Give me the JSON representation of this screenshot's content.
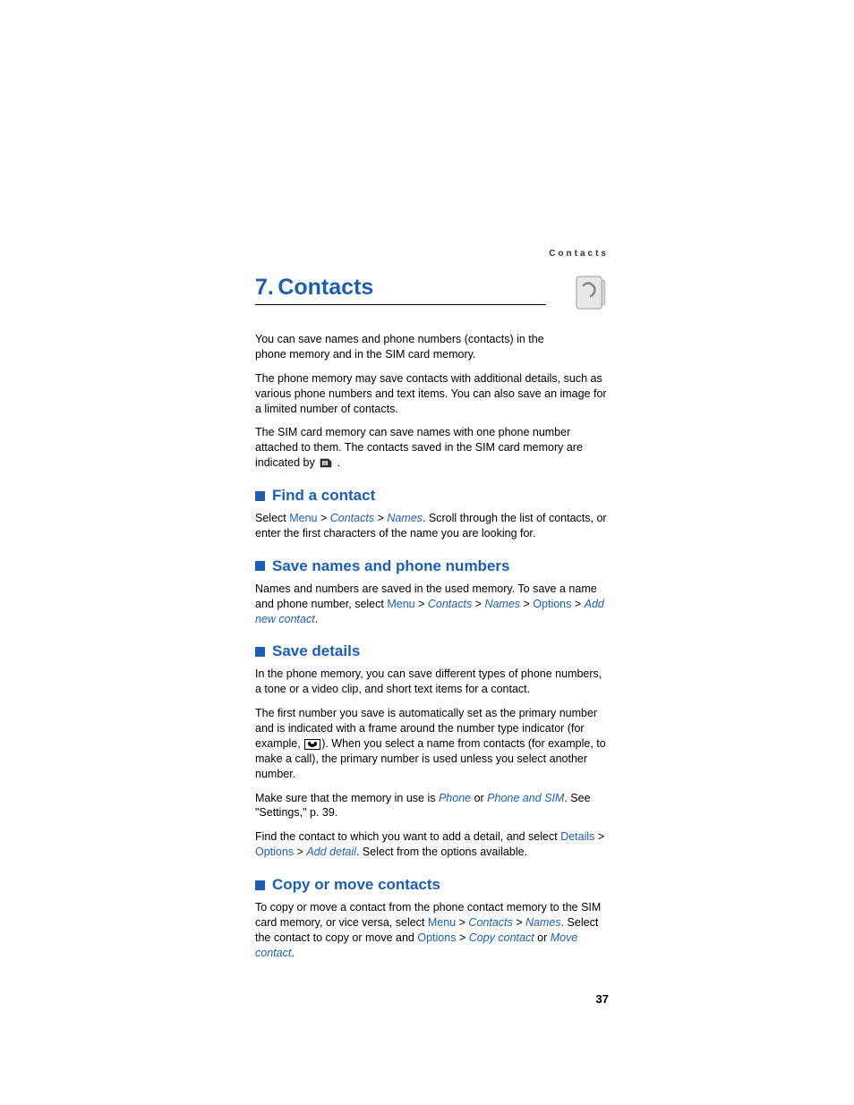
{
  "header": "Contacts",
  "chapter_number": "7.",
  "chapter_title": "Contacts",
  "intro_p1": "You can save names and phone numbers (contacts) in the phone memory and in the SIM card memory.",
  "intro_p2": "The phone memory may save contacts with additional details, such as various phone numbers and text items. You can also save an image for a limited number of contacts.",
  "intro_p3_a": "The SIM card memory can save names with one phone number attached to them. The contacts saved in the SIM card memory are indicated by ",
  "intro_p3_b": " .",
  "sections": {
    "find": {
      "title": "Find a contact",
      "text_a": "Select ",
      "menu": "Menu",
      "gt": " > ",
      "contacts": "Contacts",
      "names": "Names",
      "text_b": ". Scroll through the list of contacts, or enter the first characters of the name you are looking for."
    },
    "save_names": {
      "title": "Save names and phone numbers",
      "text_a": "Names and numbers are saved in the used memory. To save a name and phone number, select ",
      "menu": "Menu",
      "contacts": "Contacts",
      "names": "Names",
      "options": "Options",
      "add_new": "Add new contact",
      "period": "."
    },
    "save_details": {
      "title": "Save details",
      "p1": "In the phone memory, you can save different types of phone numbers, a tone or a video clip, and short text items for a contact.",
      "p2_a": "The first number you save is automatically set as the primary number and is indicated with a frame around the number type indicator (for example, ",
      "p2_b": "). When you select a name from contacts (for example, to make a call), the primary number is used unless you select another number.",
      "p3_a": "Make sure that the memory in use is ",
      "phone": "Phone",
      "or": " or ",
      "phone_sim": "Phone and SIM",
      "p3_b": ". See \"Settings,\" p. 39.",
      "p4_a": "Find the contact to which you want to add a detail, and select ",
      "details": "Details",
      "options": "Options",
      "add_detail": "Add detail",
      "p4_b": ". Select from the options available."
    },
    "copy": {
      "title": "Copy or move contacts",
      "p1_a": "To copy or move a contact from the phone contact memory to the SIM card memory, or vice versa, select ",
      "menu": "Menu",
      "contacts": "Contacts",
      "names": "Names",
      "p1_b": ". Select the contact to copy or move and ",
      "options": "Options",
      "copy_contact": "Copy contact",
      "move_contact": "Move contact",
      "period": "."
    }
  },
  "page_number": "37",
  "gt": " > ",
  "or_word": " or "
}
